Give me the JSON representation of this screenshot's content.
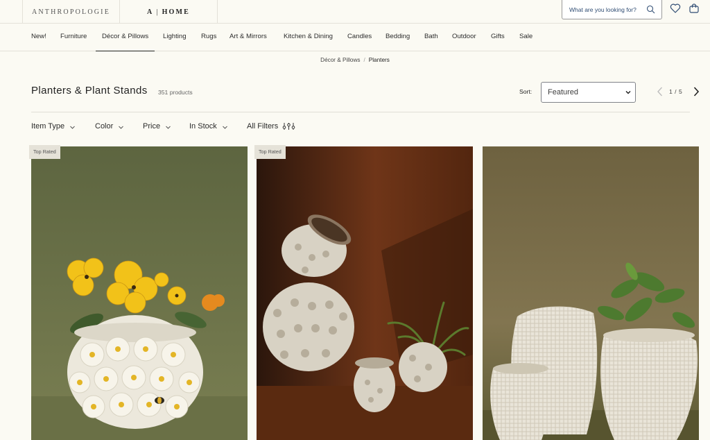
{
  "header": {
    "brands": [
      {
        "label": "ANTHROPOLOGIE"
      },
      {
        "prefix": "A",
        "label": "HOME"
      }
    ],
    "search": {
      "placeholder": "What are you looking for?"
    },
    "icons": [
      "search-icon",
      "heart-icon",
      "shopping-bag-icon"
    ]
  },
  "nav": {
    "items": [
      {
        "label": "New!"
      },
      {
        "label": "Furniture"
      },
      {
        "label": "Décor & Pillows",
        "active": true
      },
      {
        "label": "Lighting"
      },
      {
        "label": "Rugs"
      },
      {
        "label": "Art & Mirrors"
      },
      {
        "label": "Kitchen & Dining"
      },
      {
        "label": "Candles"
      },
      {
        "label": "Bedding"
      },
      {
        "label": "Bath"
      },
      {
        "label": "Outdoor"
      },
      {
        "label": "Gifts"
      },
      {
        "label": "Sale"
      }
    ]
  },
  "breadcrumb": {
    "parent": "Décor & Pillows",
    "separator": "/",
    "current": "Planters"
  },
  "page": {
    "title": "Planters & Plant Stands",
    "count": "351 products"
  },
  "sort": {
    "label": "Sort:",
    "selected": "Featured"
  },
  "pager": {
    "text": "1 / 5"
  },
  "filters": [
    {
      "label": "Item Type"
    },
    {
      "label": "Color"
    },
    {
      "label": "Price"
    },
    {
      "label": "In Stock"
    },
    {
      "label": "All Filters"
    }
  ],
  "products": [
    {
      "badge": "Top Rated",
      "image": "daisy-bee-planter-with-yellow-pansies"
    },
    {
      "badge": "Top Rated",
      "image": "textured-ceramic-planters-stack"
    },
    {
      "badge": "",
      "image": "woven-texture-twisted-planters"
    }
  ],
  "colors": {
    "background": "#fbfaf3",
    "text": "#262626",
    "search_text": "#2f4c73",
    "badge": "#e5e2d8"
  }
}
